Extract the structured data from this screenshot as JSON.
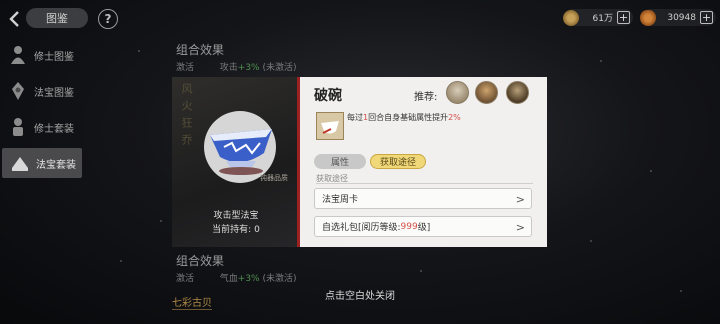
{
  "header": {
    "title": "图鉴",
    "help": "?",
    "currencies": [
      {
        "amount": "61万",
        "plus": "+",
        "icon": "copper-coin-icon"
      },
      {
        "amount": "30948",
        "plus": "+",
        "icon": "gourd-icon"
      }
    ]
  },
  "sidebar": {
    "items": [
      {
        "label": "修士图鉴",
        "icon": "cultivator-icon"
      },
      {
        "label": "法宝图鉴",
        "icon": "treasure-icon"
      },
      {
        "label": "修士套装",
        "icon": "cultivator-set-icon"
      },
      {
        "label": "法宝套装",
        "icon": "treasure-set-icon",
        "active": true
      }
    ]
  },
  "background": {
    "combo1": {
      "title": "组合效果",
      "label": "激活",
      "effect_prefix": "攻击",
      "effect_value": "+3%",
      "effect_suffix": "(未激活)"
    },
    "combo2": {
      "title": "组合效果",
      "label": "激活",
      "effect_prefix": "气血",
      "effect_value": "+3%",
      "effect_suffix": "(未激活)"
    },
    "tag": "七彩古贝"
  },
  "modal": {
    "left": {
      "vertical_text": "风火狂乔",
      "quality": "钝器品质",
      "type": "攻击型法宝",
      "owned_label": "当前持有:",
      "owned_count": "0"
    },
    "right": {
      "name": "破碗",
      "recommend_label": "推荐:",
      "skill": {
        "p1": "每过",
        "n1": "1",
        "p2": "回合自身基础属性提升",
        "n2": "2%"
      },
      "tabs": {
        "attr": "属性",
        "source": "获取途径"
      },
      "source_label": "获取途径",
      "sources": [
        {
          "text": "法宝周卡",
          "chev": ">"
        },
        {
          "p1": "自选礼包[阅历等级: ",
          "level": "999",
          "p2": "级]",
          "chev": ">"
        }
      ]
    }
  },
  "close_hint": "点击空白处关闭",
  "colors": {
    "accent_red": "#d4504a",
    "tab_gold": "#f0d777",
    "panel_border_red": "#9a2222"
  }
}
